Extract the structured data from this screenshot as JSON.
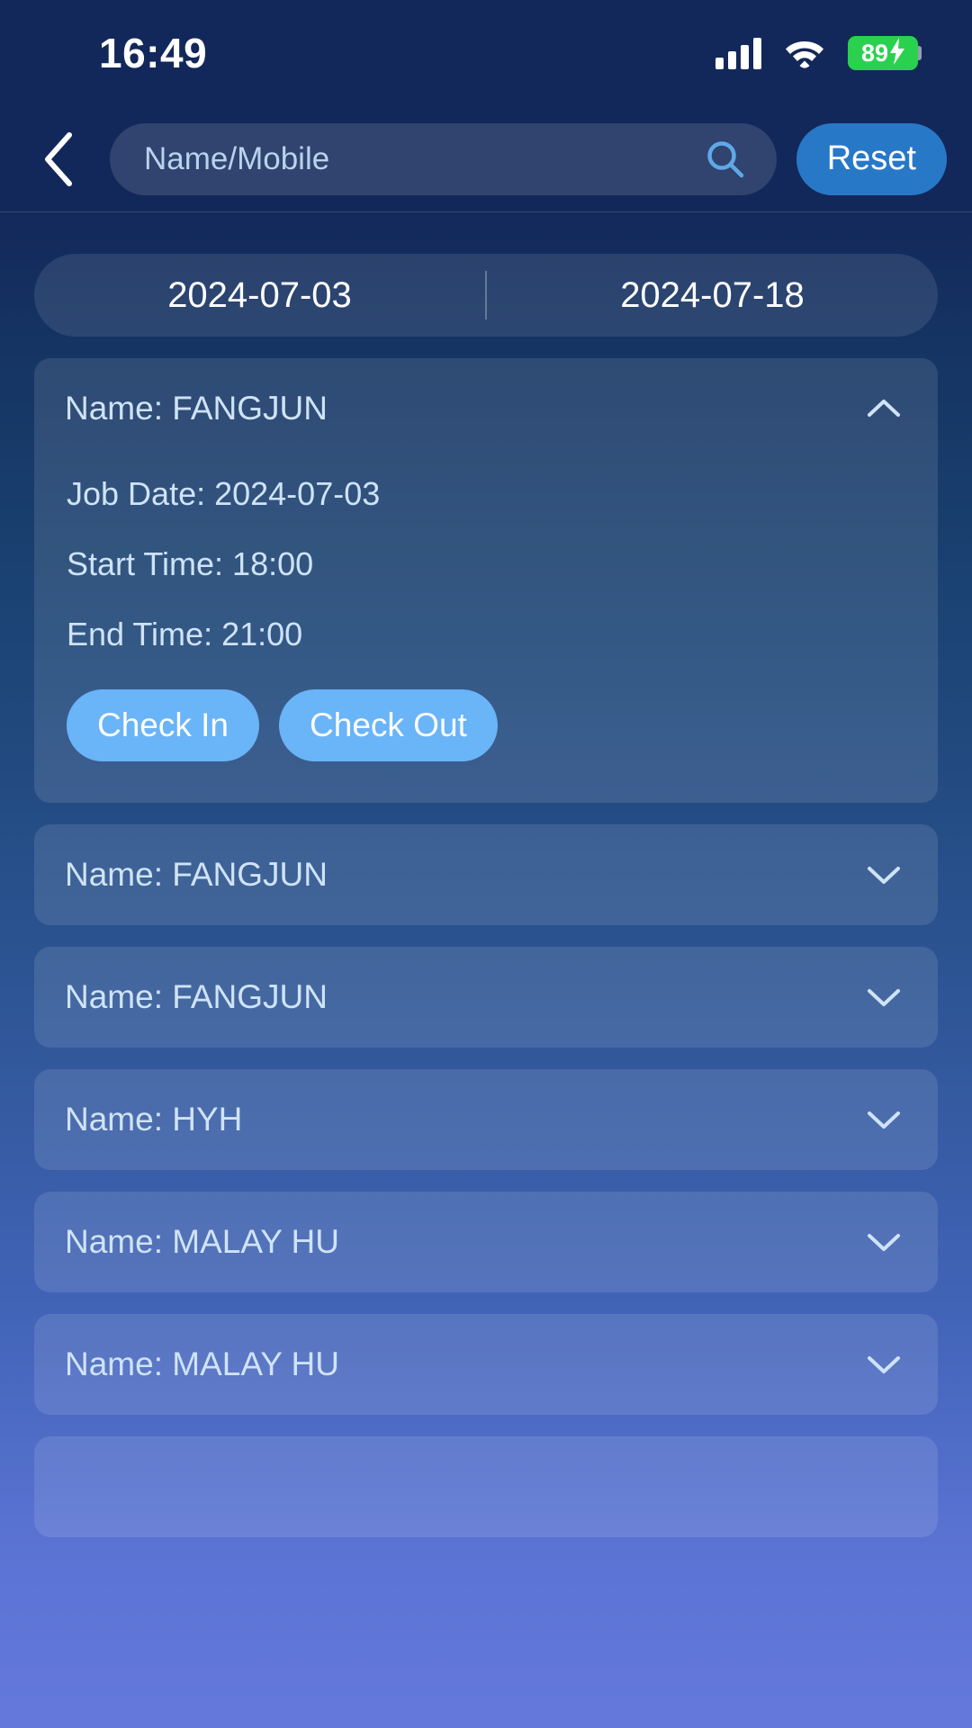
{
  "status_bar": {
    "time": "16:49",
    "signal_icon": "signal-bars-icon",
    "wifi_icon": "wifi-icon",
    "battery_percent": "89",
    "battery_charging_icon": "lightning-bolt-icon"
  },
  "header": {
    "back_icon": "chevron-left-icon",
    "search_placeholder": "Name/Mobile",
    "search_value": "",
    "search_icon": "search-icon",
    "reset_label": "Reset"
  },
  "date_range": {
    "start": "2024-07-03",
    "end": "2024-07-18"
  },
  "labels": {
    "name_prefix": "Name: ",
    "job_date_prefix": "Job Date: ",
    "start_time_prefix": "Start Time: ",
    "end_time_prefix": "End Time: ",
    "check_in": "Check In",
    "check_out": "Check Out",
    "chevron_up_icon": "chevron-up-icon",
    "chevron_down_icon": "chevron-down-icon"
  },
  "cards": [
    {
      "name": "Name: FANGJUN",
      "expanded": true,
      "job_date": "Job Date: 2024-07-03",
      "start_time": "Start Time: 18:00",
      "end_time": "End Time: 21:00",
      "check_in": "Check In",
      "check_out": "Check Out"
    },
    {
      "name": "Name: FANGJUN",
      "expanded": false
    },
    {
      "name": "Name: FANGJUN",
      "expanded": false
    },
    {
      "name": "Name: HYH",
      "expanded": false
    },
    {
      "name": "Name: MALAY HU",
      "expanded": false
    },
    {
      "name": "Name: MALAY HU",
      "expanded": false
    },
    {
      "name": "",
      "expanded": false
    }
  ],
  "colors": {
    "accent_blue": "#2878c8",
    "pill_blue": "#6ab4f8",
    "battery_green": "#2ad14f",
    "text_light": "#cfe3f7"
  }
}
